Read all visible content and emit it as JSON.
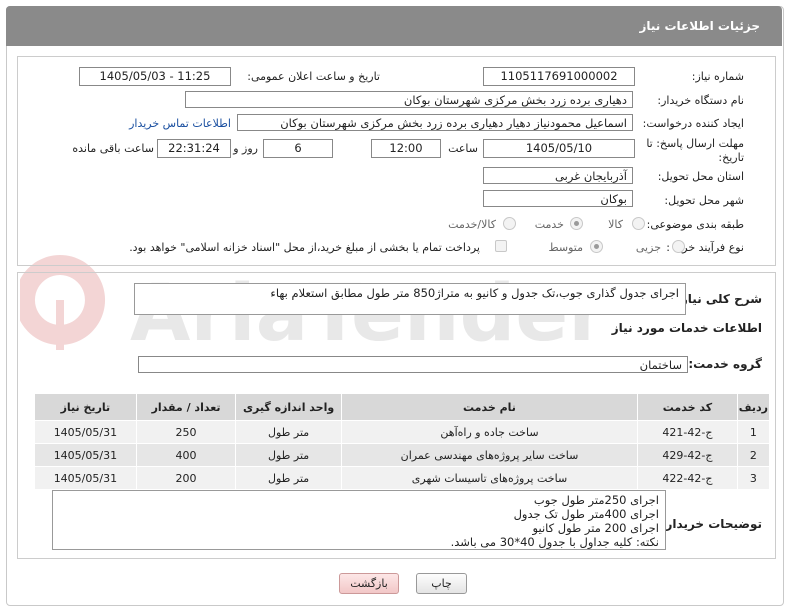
{
  "header": {
    "title": "جزئیات اطلاعات نیاز"
  },
  "form": {
    "need_number_label": "شماره نیاز:",
    "need_number": "1105117691000002",
    "announce_label": "تاریخ و ساعت اعلان عمومی:",
    "announce_value": "1405/05/03 - 11:25",
    "buyer_label": "نام دستگاه خریدار:",
    "buyer_value": "دهیاری برده زرد بخش مرکزی شهرستان بوکان",
    "creator_label": "ایجاد کننده درخواست:",
    "creator_value": "اسماعیل محمودنیاز دهیار دهیاری برده زرد بخش مرکزی شهرستان بوکان",
    "contact_link": "اطلاعات تماس خریدار",
    "deadline_label_1": "مهلت ارسال پاسخ: تا",
    "deadline_label_2": "تاریخ:",
    "deadline_date": "1405/05/10",
    "time_label": "ساعت",
    "deadline_time": "12:00",
    "days_value": "6",
    "days_label": "روز و",
    "remaining_time": "22:31:24",
    "remaining_label": "ساعت باقی مانده",
    "province_label": "استان محل تحویل:",
    "province_value": "آذربایجان غربی",
    "city_label": "شهر محل تحویل:",
    "city_value": "بوکان",
    "category_label": "طبقه بندی موضوعی:",
    "category_options": [
      "کالا",
      "خدمت",
      "کالا/خدمت"
    ],
    "category_selected": "خدمت",
    "process_label": "نوع فرآیند خرید :",
    "process_options": [
      "جزیی",
      "متوسط"
    ],
    "process_selected": "متوسط",
    "treasury_note": "پرداخت تمام یا بخشی از مبلغ خرید،از محل \"اسناد خزانه اسلامی\" خواهد بود."
  },
  "summary": {
    "label": "شرح کلی نیاز:",
    "value": "اجرای جدول گذاری جوب،تک جدول و کانیو به متراژ850 متر طول مطابق استعلام بهاء"
  },
  "services": {
    "section_title": "اطلاعات خدمات مورد نیاز",
    "group_label": "گروه خدمت:",
    "group_value": "ساختمان",
    "columns": [
      "ردیف",
      "کد خدمت",
      "نام خدمت",
      "واحد اندازه گیری",
      "تعداد / مقدار",
      "تاریخ نیاز"
    ],
    "rows": [
      [
        "1",
        "ج-42-421",
        "ساخت جاده و راه‌آهن",
        "متر طول",
        "250",
        "1405/05/31"
      ],
      [
        "2",
        "ج-42-429",
        "ساخت سایر پروژه‌های مهندسی عمران",
        "متر طول",
        "400",
        "1405/05/31"
      ],
      [
        "3",
        "ج-42-422",
        "ساخت پروژه‌های تاسیسات شهری",
        "متر طول",
        "200",
        "1405/05/31"
      ]
    ]
  },
  "buyer_notes": {
    "label": "توضیحات خریدار:",
    "lines": [
      "اجرای 250متر طول جوب",
      "اجرای 400متر طول تک جدول",
      "اجرای 200 متر طول کانیو",
      "نکته: کلیه جداول با جدول 40*30 می باشد."
    ]
  },
  "buttons": {
    "print": "چاپ",
    "back": "بازگشت"
  },
  "colors": {
    "titlebar": "#8a8a8a",
    "link": "#1a4fa0",
    "back_button": "#f2c7c7"
  }
}
